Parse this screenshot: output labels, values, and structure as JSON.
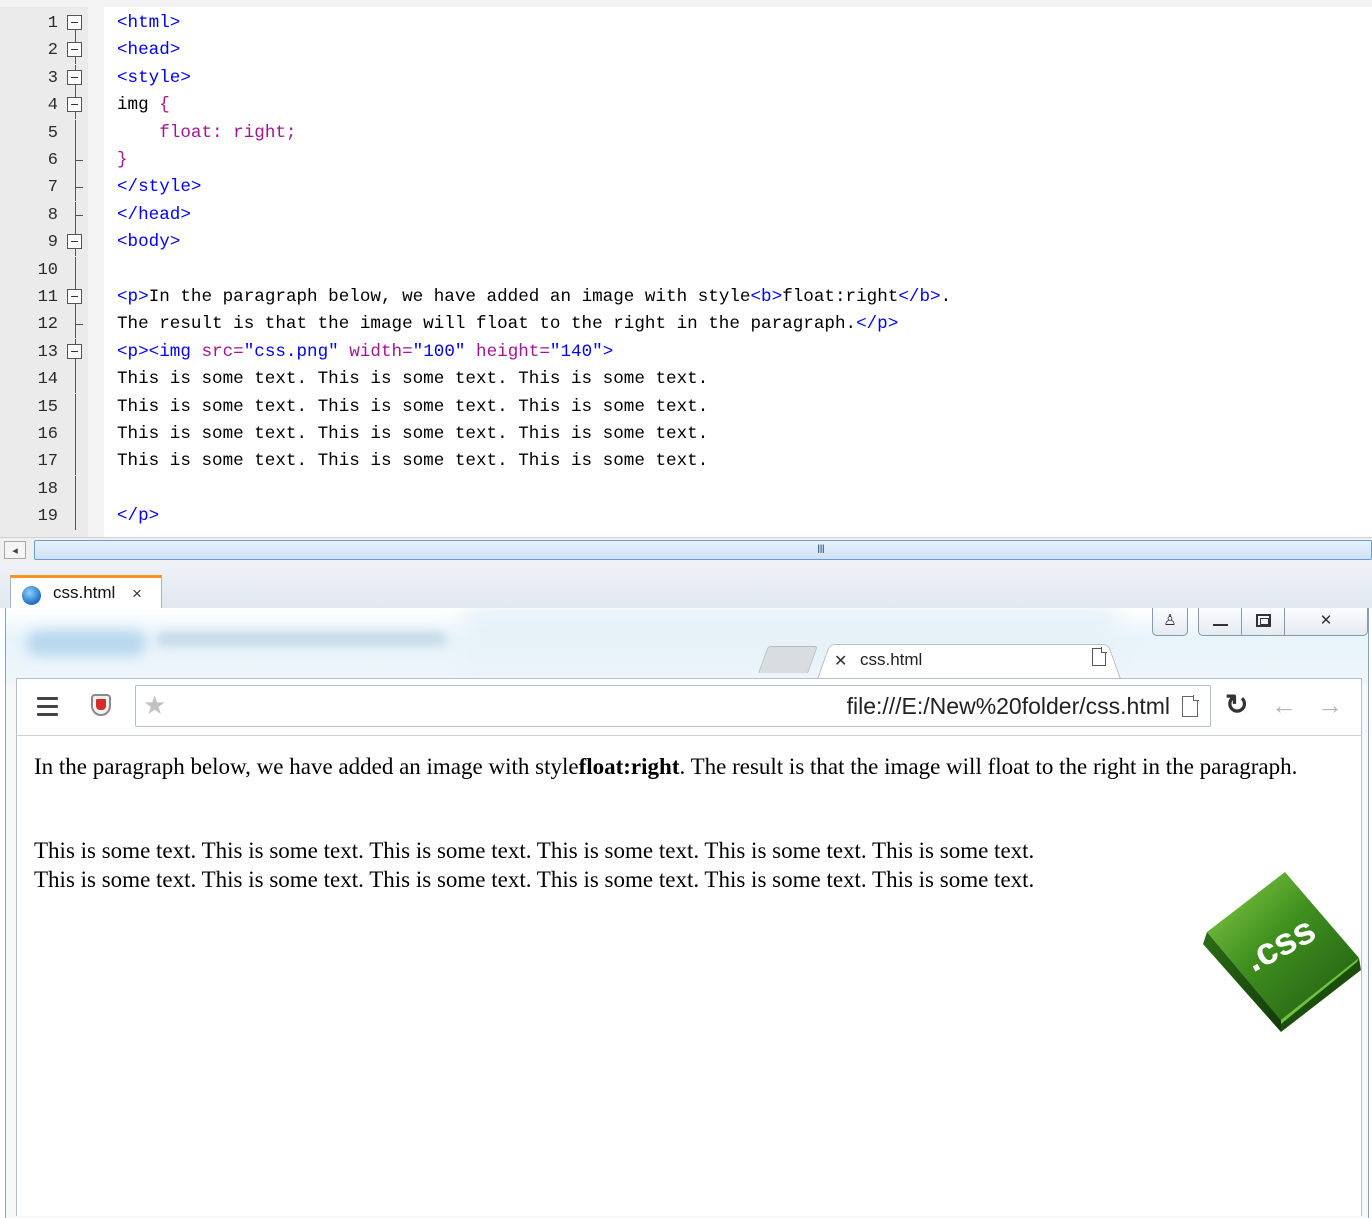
{
  "editor": {
    "lines": [
      {
        "n": "1",
        "fold": "box",
        "html": "<span class='tag'>&lt;html&gt;</span>",
        "text": "<html>"
      },
      {
        "n": "2",
        "fold": "box",
        "html": "<span class='tag'>&lt;head&gt;</span>",
        "text": "<head>"
      },
      {
        "n": "3",
        "fold": "box",
        "html": "<span class='tag'>&lt;style&gt;</span>",
        "text": "<style>"
      },
      {
        "n": "4",
        "fold": "box",
        "html": "img <span class='css-prop'>{</span>",
        "text": "img {"
      },
      {
        "n": "5",
        "fold": "line",
        "html": "    <span class='css-prop'>float: right;</span>",
        "text": "    float: right;"
      },
      {
        "n": "6",
        "fold": "tick",
        "html": "<span class='css-prop'>}</span>",
        "text": "}"
      },
      {
        "n": "7",
        "fold": "tick",
        "html": "<span class='tag'>&lt;/style&gt;</span>",
        "text": "</style>"
      },
      {
        "n": "8",
        "fold": "tick",
        "html": "<span class='tag'>&lt;/head&gt;</span>",
        "text": "</head>"
      },
      {
        "n": "9",
        "fold": "box",
        "html": "<span class='tag'>&lt;body&gt;</span>",
        "text": "<body>"
      },
      {
        "n": "10",
        "fold": "line",
        "html": "",
        "text": ""
      },
      {
        "n": "11",
        "fold": "box",
        "html": "<span class='tag'>&lt;p&gt;</span>In the paragraph below, we have added an image with style<span class='tag'>&lt;b&gt;</span>float:right<span class='tag'>&lt;/b&gt;</span>.",
        "text": "<p>In the paragraph below, we have added an image with style<b>float:right</b>."
      },
      {
        "n": "12",
        "fold": "tick",
        "html": "The result is that the image will float to the right in the paragraph.<span class='tag'>&lt;/p&gt;</span>",
        "text": "The result is that the image will float to the right in the paragraph.</p>"
      },
      {
        "n": "13",
        "fold": "box",
        "html": "<span class='tag'>&lt;p&gt;&lt;img </span><span class='attr'>src=</span><span class='tag'>\"css.png\" </span><span class='attr'>width=</span><span class='tag'>\"100\" </span><span class='attr'>height=</span><span class='tag'>\"140\"&gt;</span>",
        "text": "<p><img src=\"css.png\" width=\"100\" height=\"140\">"
      },
      {
        "n": "14",
        "fold": "line",
        "html": "This is some text. This is some text. This is some text.",
        "text": "This is some text. This is some text. This is some text."
      },
      {
        "n": "15",
        "fold": "line",
        "html": "This is some text. This is some text. This is some text.",
        "text": "This is some text. This is some text. This is some text."
      },
      {
        "n": "16",
        "fold": "line",
        "html": "This is some text. This is some text. This is some text.",
        "text": "This is some text. This is some text. This is some text."
      },
      {
        "n": "17",
        "fold": "line",
        "html": "This is some text. This is some text. This is some text.",
        "text": "This is some text. This is some text. This is some text."
      },
      {
        "n": "18",
        "fold": "line",
        "html": "",
        "text": ""
      },
      {
        "n": "19",
        "fold": "line",
        "html": "<span class='tag'>&lt;/p&gt;</span>",
        "text": "</p>"
      }
    ],
    "scroll_grip": "III",
    "scroll_left_arrow": "◂"
  },
  "doc_tab": {
    "label": "css.html",
    "close": "×"
  },
  "window_controls": {
    "user": "♙",
    "close": "✕"
  },
  "browser": {
    "tab_title": "css.html",
    "tab_close": "✕",
    "url": "file:///E:/New%20folder/css.html",
    "star": "★",
    "reload": "↻",
    "back": "←",
    "forward": "→"
  },
  "page": {
    "p1_before": "In the paragraph below, we have added an image with style",
    "p1_bold": "float:right",
    "p1_after": ". The result is that the image will float to the right in the paragraph.",
    "p2_line1": "This is some text. This is some text. This is some text. This is some text. This is some text. This is some text.",
    "p2_line2": "This is some text. This is some text. This is some text. This is some text. This is some text. This is some text.",
    "logo_text": ".css"
  },
  "colors": {
    "tag": "#0000ff",
    "attr": "#a31591",
    "tab_accent": "#f7931e",
    "logo_green": "#3f8f1f"
  }
}
